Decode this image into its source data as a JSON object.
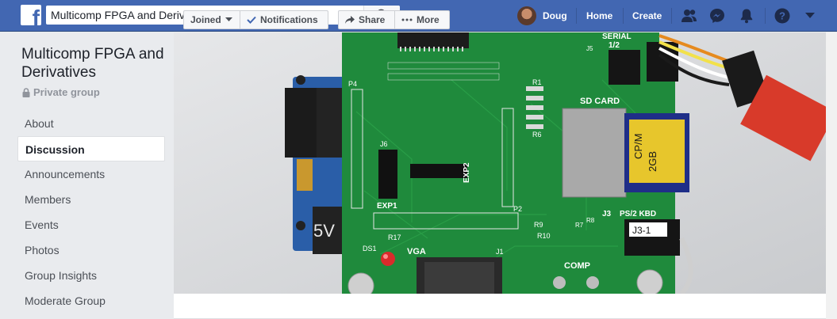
{
  "topbar": {
    "search_value": "Multicomp FPGA and Derivatives",
    "user_name": "Doug",
    "home_label": "Home",
    "create_label": "Create"
  },
  "group": {
    "name": "Multicomp FPGA and Derivatives",
    "privacy": "Private group"
  },
  "sidebar": {
    "items": [
      {
        "label": "About"
      },
      {
        "label": "Discussion"
      },
      {
        "label": "Announcements"
      },
      {
        "label": "Members"
      },
      {
        "label": "Events"
      },
      {
        "label": "Photos"
      },
      {
        "label": "Group Insights"
      },
      {
        "label": "Moderate Group"
      }
    ]
  },
  "actions": {
    "joined_label": "Joined",
    "notifications_label": "Notifications",
    "share_label": "Share",
    "more_label": "More"
  },
  "cover": {
    "board_labels": {
      "serial": "SERIAL",
      "serial_sub": "1/2",
      "sd_card": "SD CARD",
      "ps2": "PS/2 KBD",
      "vga": "VGA",
      "comp": "COMP",
      "exp1": "EXP1",
      "exp2": "EXP2",
      "j3": "J3",
      "j31": "J3-1",
      "p4": "P4",
      "j6": "J6",
      "j5": "J5",
      "r1": "R1",
      "r6": "R6",
      "p2": "P2",
      "ds1": "DS1",
      "j1": "J1",
      "r17": "R17",
      "r9": "R9",
      "r10": "R10",
      "r7": "R7",
      "r8": "R8",
      "cpm": "CP/M",
      "cpm2": "2GB",
      "v5": "5V"
    }
  },
  "colors": {
    "topbar": "#4267b2",
    "pcb": "#1f8a3c",
    "background": "#e9ebee"
  }
}
